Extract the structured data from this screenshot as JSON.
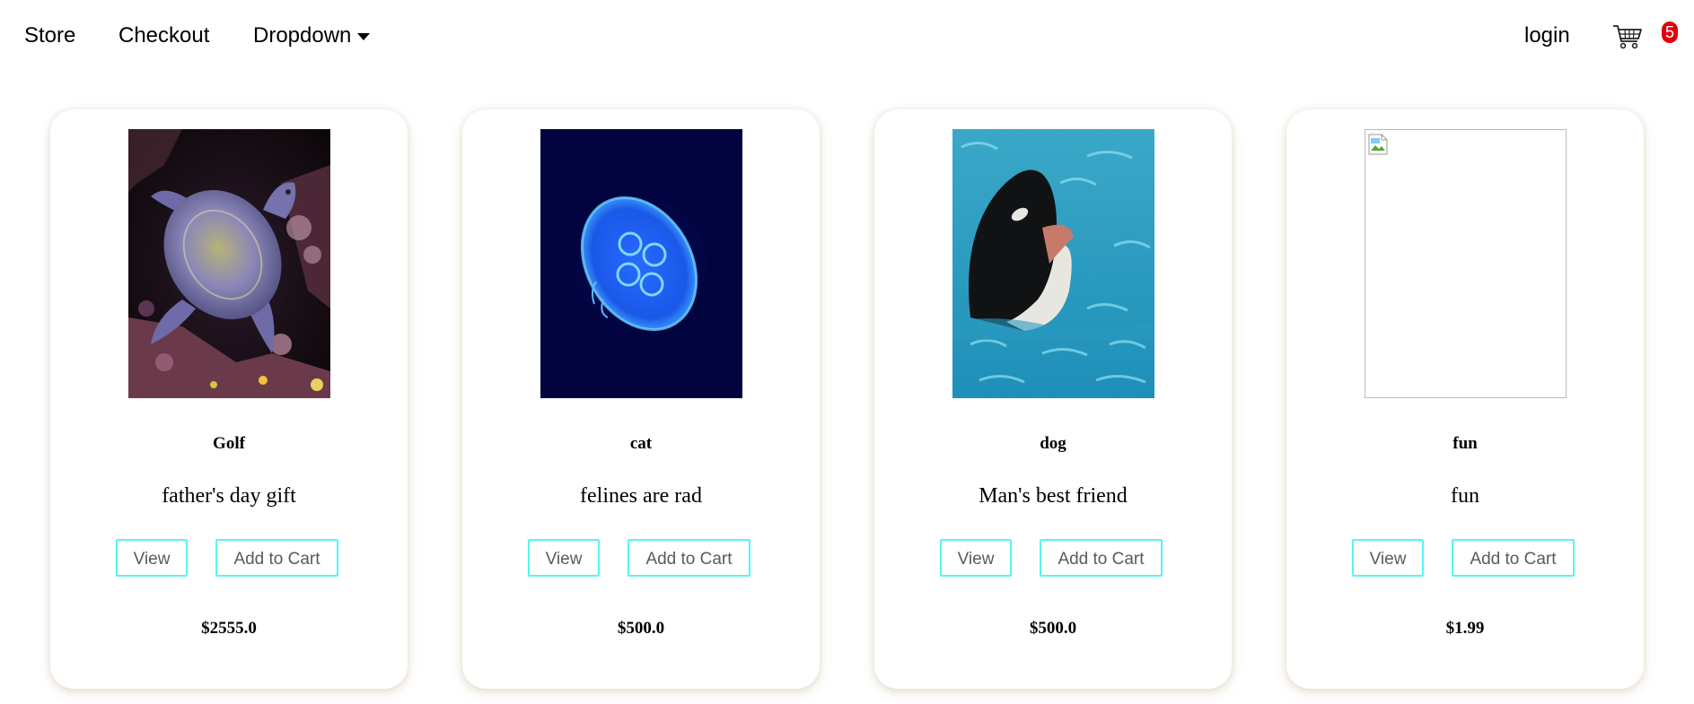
{
  "nav": {
    "store": "Store",
    "checkout": "Checkout",
    "dropdown": "Dropdown",
    "login": "login",
    "cart_icon": "shopping-cart-icon",
    "cart_count": "5",
    "badge_color": "#e0000a"
  },
  "products": [
    {
      "name": "Golf",
      "description": "father's day gift",
      "view_label": "View",
      "add_label": "Add to Cart",
      "price": "$2555.0",
      "image": "sea-turtle-photo"
    },
    {
      "name": "cat",
      "description": "felines are rad",
      "view_label": "View",
      "add_label": "Add to Cart",
      "price": "$500.0",
      "image": "jellyfish-photo"
    },
    {
      "name": "dog",
      "description": "Man's best friend",
      "view_label": "View",
      "add_label": "Add to Cart",
      "price": "$500.0",
      "image": "orca-photo"
    },
    {
      "name": "fun",
      "description": "fun",
      "view_label": "View",
      "add_label": "Add to Cart",
      "price": "$1.99",
      "image": "broken-image-icon"
    }
  ],
  "colors": {
    "button_border": "#55f5f5",
    "button_text": "#5a5a5a"
  }
}
